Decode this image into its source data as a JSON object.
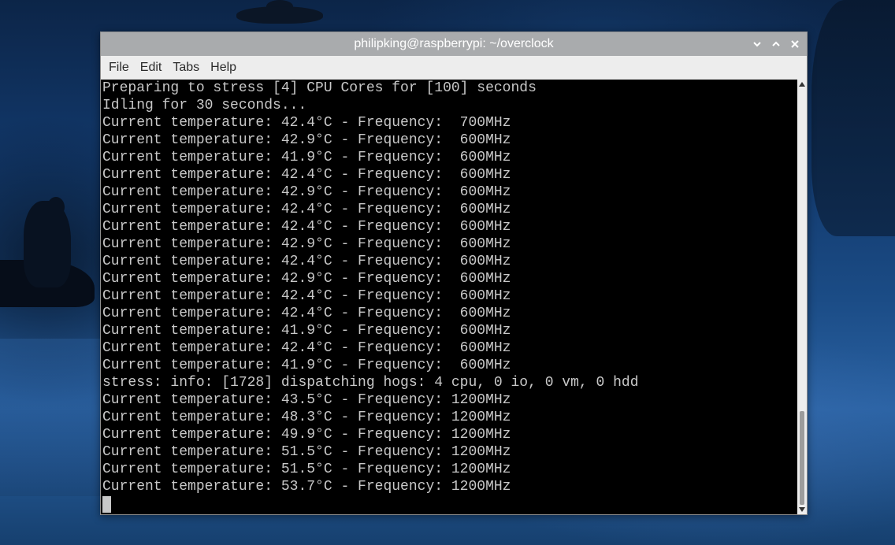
{
  "window": {
    "title": "philipking@raspberrypi: ~/overclock"
  },
  "menu": {
    "items": [
      "File",
      "Edit",
      "Tabs",
      "Help"
    ]
  },
  "terminal": {
    "lines": [
      "Preparing to stress [4] CPU Cores for [100] seconds",
      "Idling for 30 seconds...",
      "Current temperature: 42.4°C - Frequency:  700MHz",
      "Current temperature: 42.9°C - Frequency:  600MHz",
      "Current temperature: 41.9°C - Frequency:  600MHz",
      "Current temperature: 42.4°C - Frequency:  600MHz",
      "Current temperature: 42.9°C - Frequency:  600MHz",
      "Current temperature: 42.4°C - Frequency:  600MHz",
      "Current temperature: 42.4°C - Frequency:  600MHz",
      "Current temperature: 42.9°C - Frequency:  600MHz",
      "Current temperature: 42.4°C - Frequency:  600MHz",
      "Current temperature: 42.9°C - Frequency:  600MHz",
      "Current temperature: 42.4°C - Frequency:  600MHz",
      "Current temperature: 42.4°C - Frequency:  600MHz",
      "Current temperature: 41.9°C - Frequency:  600MHz",
      "Current temperature: 42.4°C - Frequency:  600MHz",
      "Current temperature: 41.9°C - Frequency:  600MHz",
      "stress: info: [1728] dispatching hogs: 4 cpu, 0 io, 0 vm, 0 hdd",
      "Current temperature: 43.5°C - Frequency: 1200MHz",
      "Current temperature: 48.3°C - Frequency: 1200MHz",
      "Current temperature: 49.9°C - Frequency: 1200MHz",
      "Current temperature: 51.5°C - Frequency: 1200MHz",
      "Current temperature: 51.5°C - Frequency: 1200MHz",
      "Current temperature: 53.7°C - Frequency: 1200MHz"
    ],
    "background_color": "#000000",
    "text_color": "#c8c8c8"
  },
  "scrollbar": {
    "thumb_start_fraction": 0.775,
    "thumb_end_fraction": 1.0
  },
  "icons": {
    "minimize": "chevron-down-icon",
    "maximize": "chevron-up-icon",
    "close": "close-icon",
    "scroll_up": "scroll-up-arrow-icon",
    "scroll_down": "scroll-down-arrow-icon"
  }
}
